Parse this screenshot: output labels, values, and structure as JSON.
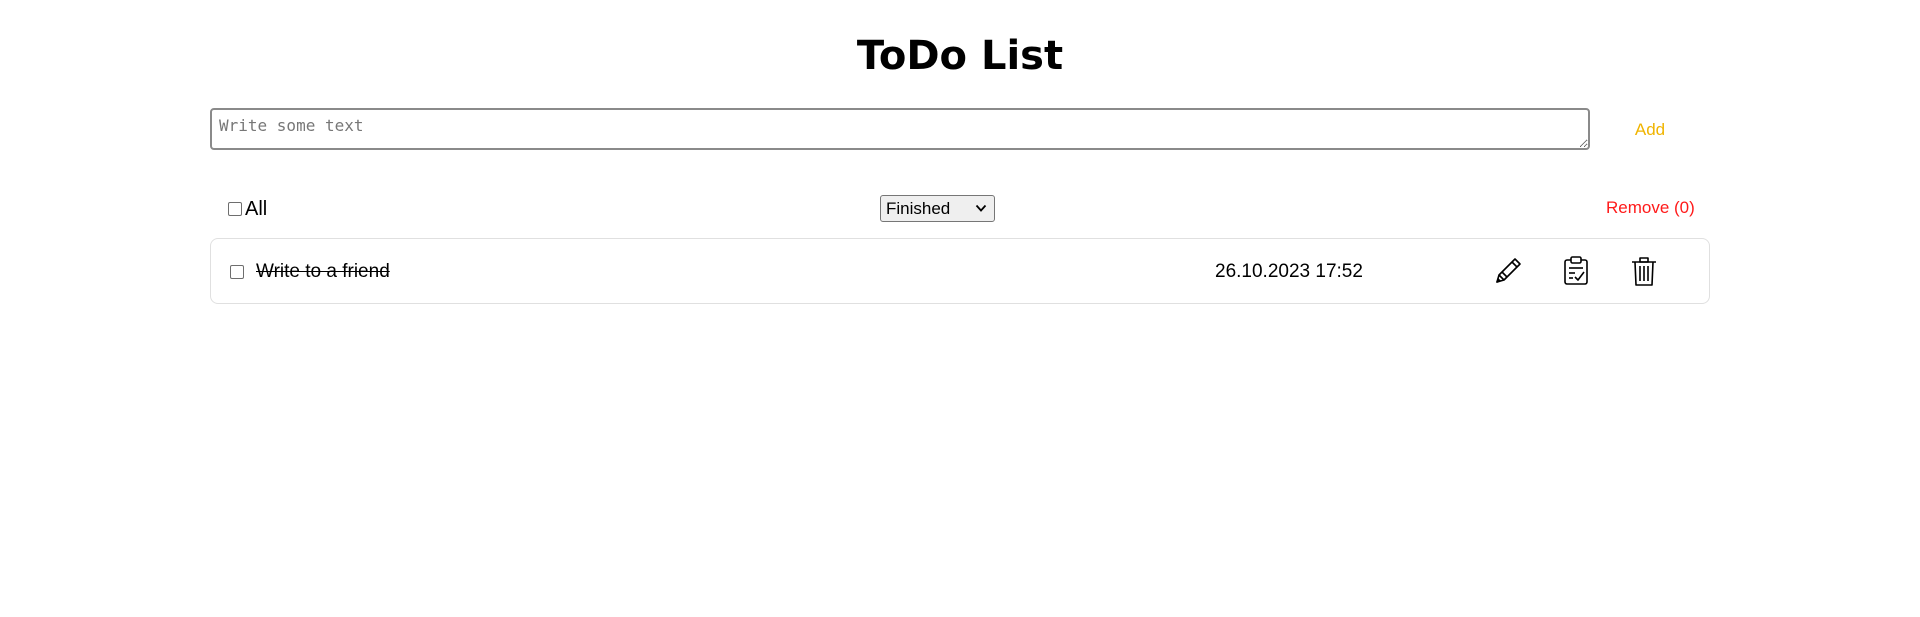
{
  "header": {
    "title": "ToDo List"
  },
  "composer": {
    "placeholder": "Write some text",
    "value": "",
    "add_label": "Add"
  },
  "controls": {
    "select_all_label": "All",
    "select_all_checked": false,
    "filter_selected": "Finished",
    "remove_label": "Remove (0)"
  },
  "todos": [
    {
      "text": "Write to a friend",
      "date": "26.10.2023 17:52",
      "checked": false,
      "finished": true,
      "actions": [
        "pencil-icon",
        "clipboard-check-icon",
        "trash-icon"
      ]
    }
  ],
  "colors": {
    "add": "#f0b400",
    "remove": "#ff1a1a",
    "border": "#e0e0e0"
  }
}
